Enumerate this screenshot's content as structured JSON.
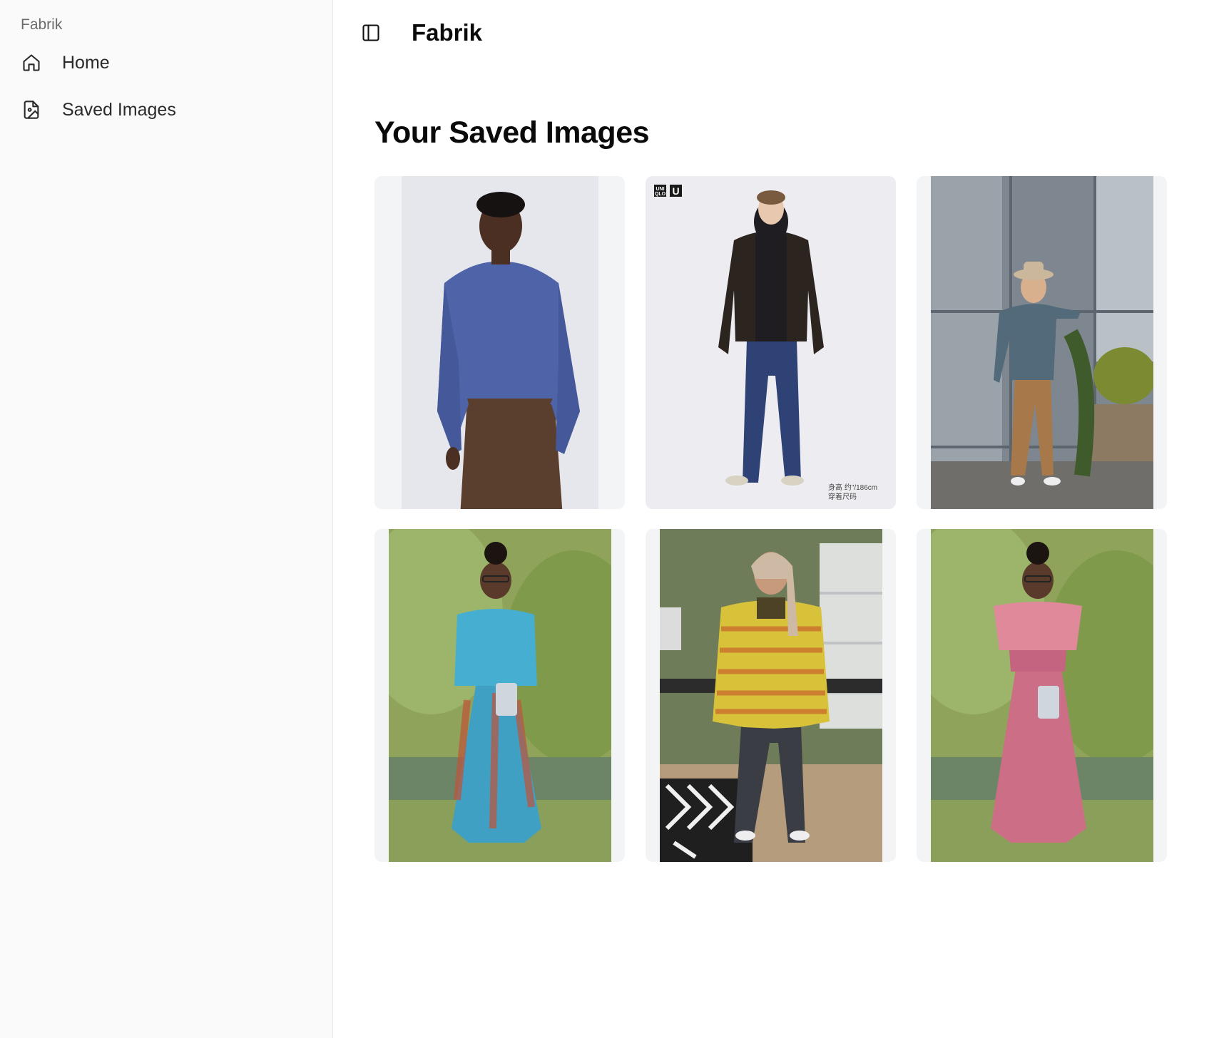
{
  "sidebar": {
    "brand": "Fabrik",
    "items": [
      {
        "label": "Home",
        "icon": "home-icon"
      },
      {
        "label": "Saved Images",
        "icon": "image-file-icon"
      }
    ]
  },
  "header": {
    "toggle_icon": "sidebar-toggle-icon",
    "title": "Fabrik"
  },
  "main": {
    "heading": "Your Saved Images",
    "images": [
      {
        "subject": "person in blue sweatshirt and brown trousers"
      },
      {
        "subject": "person in dark jacket, hoodie and navy pants",
        "logo_text": [
          "UNI",
          "QLO"
        ],
        "badge_letter": "U",
        "caption_lines": [
          "身高 约\"/186cm",
          "穿着尺码"
        ]
      },
      {
        "subject": "person in hat and plaid shirt by greenhouse"
      },
      {
        "subject": "woman in blue patterned maxi dress outdoors"
      },
      {
        "subject": "person in yellow striped cardigan in office"
      },
      {
        "subject": "woman in pink off-shoulder dress outdoors"
      }
    ]
  },
  "colors": {
    "sidebar_bg": "#fafafa",
    "card_bg": "#f3f4f6",
    "text_primary": "#0a0a0a",
    "text_muted": "#6b6b6b"
  }
}
